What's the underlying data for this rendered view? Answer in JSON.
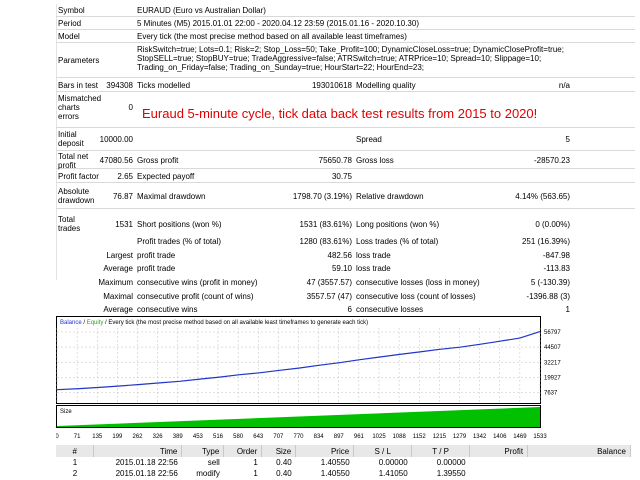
{
  "info": {
    "symbol": {
      "label": "Symbol",
      "value": "EURAUD (Euro vs Australian Dollar)"
    },
    "period": {
      "label": "Period",
      "value": "5 Minutes (M5) 2015.01.01 22:00 - 2020.04.12 23:59 (2015.01.16 - 2020.10.30)"
    },
    "model": {
      "label": "Model",
      "value": "Every tick (the most precise method based on all available least timeframes)"
    },
    "parameters": {
      "label": "Parameters",
      "lines": [
        "RiskSwitch=true; Lots=0.1; Risk=2; Stop_Loss=50; Take_Profit=100; DynamicCloseLoss=true; DynamicCloseProfit=true;",
        "StopSELL=true; StopBUY=true; TradeAggressive=false; ATRSwitch=true; ATRPrice=10; Spread=10; Slippage=10;",
        "Trading_on_Friday=false; Trading_on_Sunday=true; HourStart=22; HourEnd=23;"
      ]
    }
  },
  "summary": {
    "bars_in_test": {
      "label": "Bars in test",
      "value": "394308"
    },
    "ticks_modelled": {
      "label": "Ticks modelled",
      "value": "193010618"
    },
    "modelling_quality": {
      "label": "Modelling quality",
      "value": "n/a"
    },
    "mismatched": {
      "label_lines": [
        "Mismatched",
        "charts",
        "errors"
      ],
      "value": "0"
    },
    "initial_deposit": {
      "label_lines": [
        "Initial",
        "deposit"
      ],
      "value": "10000.00"
    },
    "spread": {
      "label": "Spread",
      "value": "5"
    },
    "total_net_profit": {
      "label_lines": [
        "Total net",
        "profit"
      ],
      "value": "47080.56"
    },
    "gross_profit": {
      "label": "Gross profit",
      "value": "75650.78"
    },
    "gross_loss": {
      "label": "Gross loss",
      "value": "-28570.23"
    },
    "profit_factor": {
      "label": "Profit factor",
      "value": "2.65"
    },
    "expected_payoff": {
      "label": "Expected payoff",
      "value": "30.75"
    },
    "absolute_drawdown": {
      "label_lines": [
        "Absolute",
        "drawdown"
      ],
      "value": "76.87"
    },
    "maximal_drawdown": {
      "label": "Maximal drawdown",
      "value": "1798.70 (3.19%)"
    },
    "relative_drawdown": {
      "label": "Relative drawdown",
      "value": "4.14% (563.65)"
    },
    "total_trades": {
      "label_lines": [
        "Total",
        "trades"
      ],
      "value": "1531"
    },
    "short_positions": {
      "label": "Short positions (won %)",
      "value": "1531 (83.61%)"
    },
    "long_positions": {
      "label": "Long positions (won %)",
      "value": "0 (0.00%)"
    },
    "profit_trades": {
      "label": "Profit trades (% of total)",
      "value": "1280 (83.61%)"
    },
    "loss_trades": {
      "label": "Loss trades (% of total)",
      "value": "251 (16.39%)"
    },
    "largest_profit": {
      "prefix": "Largest",
      "label": "profit trade",
      "value": "482.56"
    },
    "largest_loss": {
      "label": "loss trade",
      "value": "-847.98"
    },
    "average_profit": {
      "prefix": "Average",
      "label": "profit trade",
      "value": "59.10"
    },
    "average_loss": {
      "label": "loss trade",
      "value": "-113.83"
    },
    "max_consec_wins": {
      "prefix": "Maximum",
      "label": "consecutive wins (profit in money)",
      "value": "47 (3557.57)"
    },
    "max_consec_losses": {
      "label": "consecutive losses (loss in money)",
      "value": "5 (-130.39)"
    },
    "maximal_consec_profit": {
      "prefix": "Maximal",
      "label": "consecutive profit (count of wins)",
      "value": "3557.57 (47)"
    },
    "maximal_consec_loss": {
      "label": "consecutive loss (count of losses)",
      "value": "-1396.88 (3)"
    },
    "avg_consec_wins": {
      "prefix": "Average",
      "label": "consecutive wins",
      "value": "6"
    },
    "avg_consec_losses": {
      "label": "consecutive losses",
      "value": "1"
    }
  },
  "overlay_text": "Euraud 5-minute cycle, tick data back test results from 2015 to 2020!",
  "chart_data": {
    "type": "line",
    "legend": {
      "balance": "Balance",
      "sep": " / ",
      "equity": "Equity",
      "rest": " / Every tick (the most precise method based on all available least timeframes to generate each tick)"
    },
    "size_label": "Size",
    "colors": {
      "balance": "#1f35c9",
      "equity": "#2e9e2e",
      "size": "#00c000",
      "grid": "#c0c0c0"
    },
    "ylim": [
      0,
      60000
    ],
    "y_ticks": [
      {
        "value": 56797,
        "label": "56797"
      },
      {
        "value": 44507,
        "label": "44507"
      },
      {
        "value": 32217,
        "label": "32217"
      },
      {
        "value": 19927,
        "label": "19927"
      },
      {
        "value": 7637,
        "label": "7637"
      }
    ],
    "x_ticks": [
      "0",
      "71",
      "135",
      "199",
      "262",
      "326",
      "389",
      "453",
      "516",
      "580",
      "643",
      "707",
      "770",
      "834",
      "897",
      "961",
      "1025",
      "1088",
      "1152",
      "1215",
      "1279",
      "1342",
      "1406",
      "1469",
      "1533"
    ],
    "xlim": [
      0,
      1533
    ],
    "series": [
      {
        "name": "Balance",
        "x": [
          0,
          71,
          135,
          199,
          262,
          326,
          389,
          453,
          516,
          580,
          643,
          707,
          770,
          834,
          897,
          961,
          1025,
          1088,
          1152,
          1215,
          1279,
          1342,
          1406,
          1469,
          1533
        ],
        "values": [
          10000,
          10900,
          11800,
          13000,
          14200,
          15500,
          16800,
          18600,
          20200,
          22100,
          23700,
          25700,
          27600,
          29800,
          31900,
          34300,
          36500,
          38600,
          40600,
          42700,
          44400,
          46800,
          49300,
          51800,
          57080
        ]
      }
    ],
    "size_bars": [
      0.05,
      1.0
    ]
  },
  "trades": {
    "headers": [
      "#",
      "Time",
      "Type",
      "Order",
      "Size",
      "Price",
      "S / L",
      "T / P",
      "Profit",
      "Balance"
    ],
    "rows": [
      [
        "1",
        "2015.01.18 22:56",
        "sell",
        "1",
        "0.40",
        "1.40550",
        "0.00000",
        "0.00000",
        "",
        ""
      ],
      [
        "2",
        "2015.01.18 22:56",
        "modify",
        "1",
        "0.40",
        "1.40550",
        "1.41050",
        "1.39550",
        "",
        ""
      ]
    ]
  }
}
